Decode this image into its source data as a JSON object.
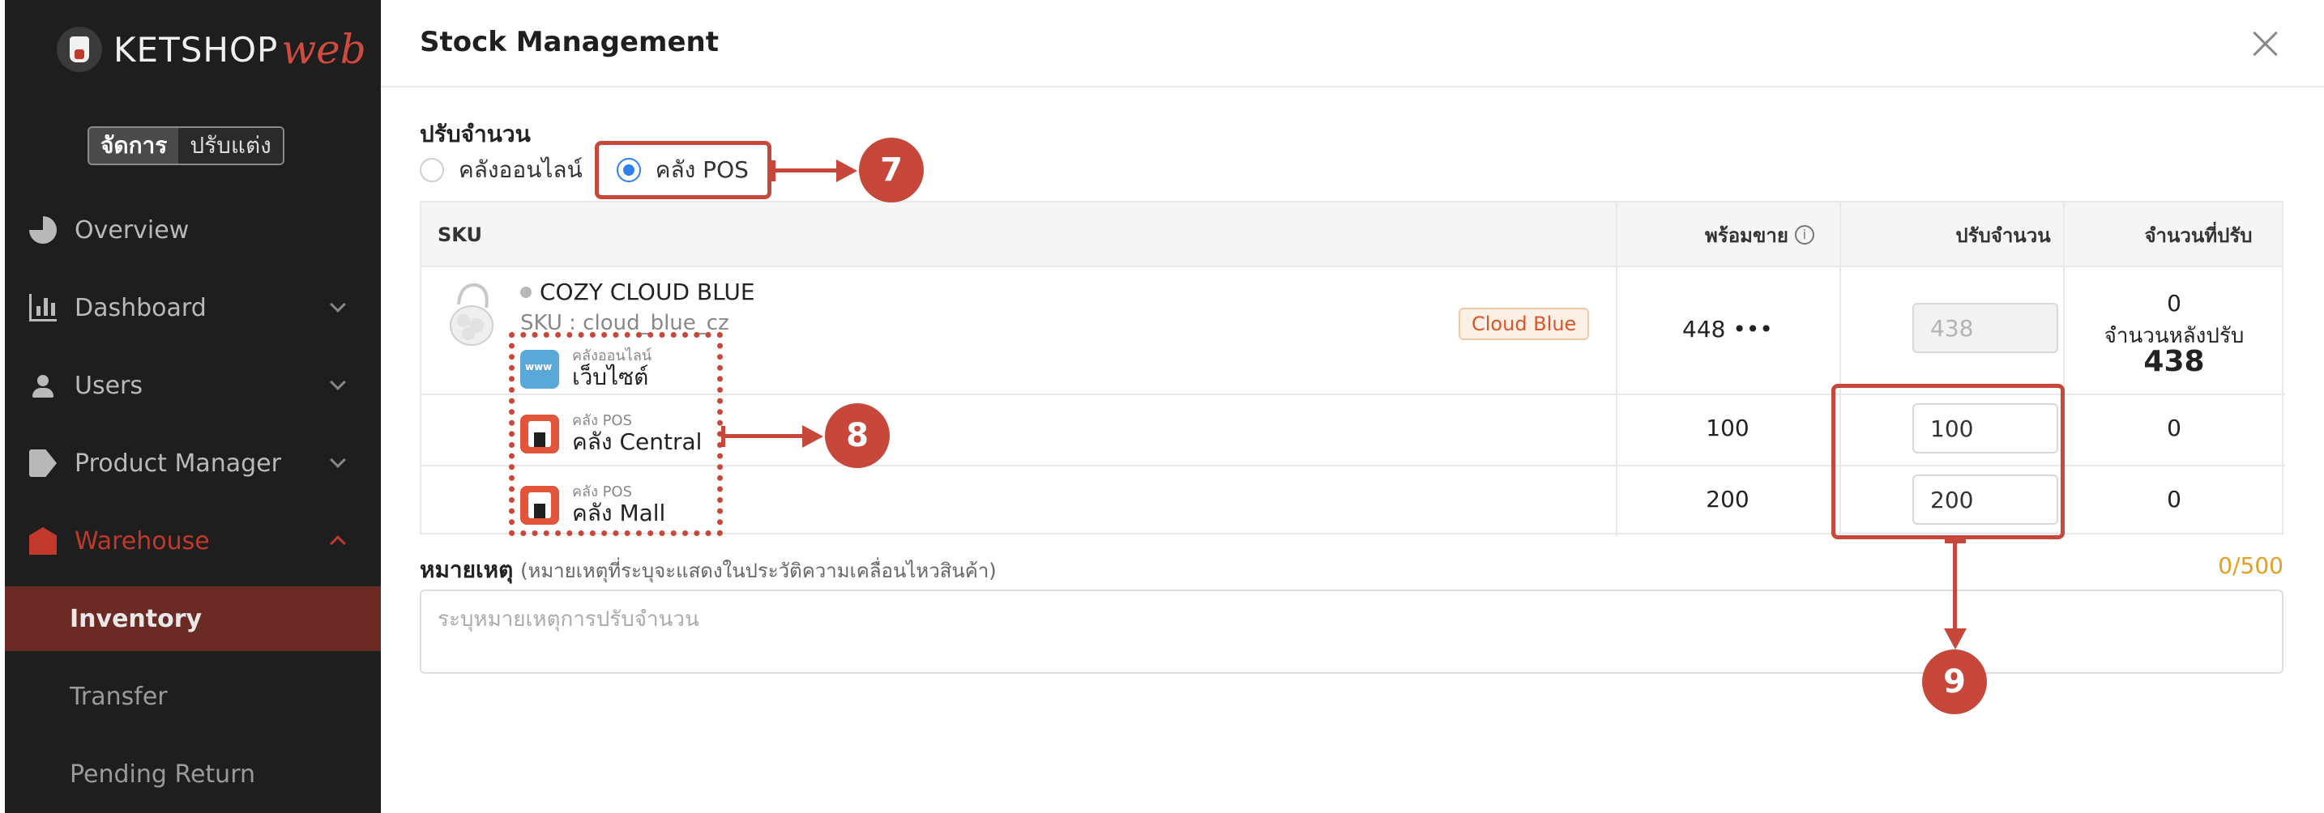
{
  "brand": {
    "name_main": "KETSHOP",
    "name_accent": "web"
  },
  "mode_toggle": {
    "active": "จัดการ",
    "inactive": "ปรับแต่ง"
  },
  "sidebar": {
    "items": [
      {
        "label": "Overview",
        "icon": "pie-chart-icon"
      },
      {
        "label": "Dashboard",
        "icon": "bar-chart-icon"
      },
      {
        "label": "Users",
        "icon": "users-icon"
      },
      {
        "label": "Product Manager",
        "icon": "tag-icon"
      },
      {
        "label": "Warehouse",
        "icon": "warehouse-icon"
      }
    ],
    "sub_items": [
      {
        "label": "Inventory"
      },
      {
        "label": "Transfer"
      },
      {
        "label": "Pending Return"
      }
    ]
  },
  "modal": {
    "title": "Stock Management",
    "section_label": "ปรับจำนวน",
    "radio_online": "คลังออนไลน์",
    "radio_pos": "คลัง POS",
    "columns": {
      "sku": "SKU",
      "available": "พร้อมขาย",
      "adjust": "ปรับจำนวน",
      "adjusted": "จำนวนที่ปรับ"
    },
    "product": {
      "name": "COZY CLOUD BLUE",
      "sku": "SKU : cloud_blue_cz",
      "badge": "Cloud Blue"
    },
    "rows": [
      {
        "store_type": "คลังออนไลน์",
        "store_name": "เว็บไซต์",
        "available": "448 •••",
        "adjust": "438",
        "adjusted": "0",
        "after_label": "จำนวนหลังปรับ",
        "after_value": "438"
      },
      {
        "store_type": "คลัง POS",
        "store_name": "คลัง Central",
        "available": "100",
        "adjust": "100",
        "adjusted": "0"
      },
      {
        "store_type": "คลัง POS",
        "store_name": "คลัง Mall",
        "available": "200",
        "adjust": "200",
        "adjusted": "0"
      }
    ],
    "note_label": "หมายเหตุ",
    "note_hint": "(หมายเหตุที่ระบุจะแสดงในประวัติความเคลื่อนไหวสินค้า)",
    "note_counter": "0/500",
    "note_placeholder": "ระบุหมายเหตุการปรับจำนวน"
  },
  "annotations": {
    "step7": "7",
    "step8": "8",
    "step9": "9"
  },
  "colors": {
    "accent": "#c0392b",
    "annotation": "#c7473a",
    "sidebar_bg": "#1e1e1e",
    "radio": "#2f80ed",
    "counter": "#e5a023"
  }
}
